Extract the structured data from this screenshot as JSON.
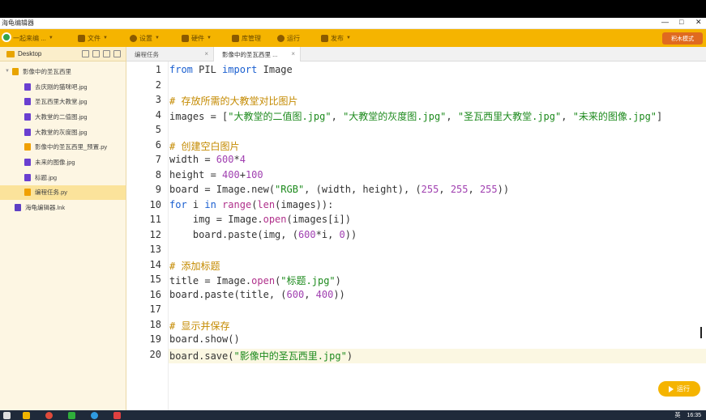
{
  "window": {
    "title": "海龟编辑器",
    "controls": [
      "—",
      "□",
      "✕"
    ]
  },
  "menubar": {
    "account": "一起来编 ...",
    "items": [
      {
        "label": "文件",
        "icon": "folder-icon"
      },
      {
        "label": "设置",
        "icon": "gear-icon"
      },
      {
        "label": "硬件",
        "icon": "hardware-icon"
      },
      {
        "label": "库管理",
        "icon": "library-icon"
      },
      {
        "label": "运行",
        "icon": "run-icon"
      },
      {
        "label": "发布",
        "icon": "publish-icon"
      }
    ],
    "mode_button": "积木模式"
  },
  "sidebar": {
    "root": "Desktop",
    "folder": "影像中的圣瓦西里",
    "files": [
      {
        "name": "去庆刚的猫咪吧.jpg",
        "type": "img"
      },
      {
        "name": "圣瓦西里大教堂.jpg",
        "type": "img"
      },
      {
        "name": "大教堂的二值图.jpg",
        "type": "img"
      },
      {
        "name": "大教堂的灰度图.jpg",
        "type": "img"
      },
      {
        "name": "影像中的圣瓦西里_预置.py",
        "type": "py"
      },
      {
        "name": "未来的图像.jpg",
        "type": "img"
      },
      {
        "name": "标题.jpg",
        "type": "img"
      },
      {
        "name": "编程任务.py",
        "type": "py",
        "selected": true
      }
    ],
    "extra": {
      "name": "海龟编辑器.lnk",
      "type": "lnk"
    }
  },
  "tabs": [
    {
      "label": "编程任务",
      "active": false
    },
    {
      "label": "影像中的圣瓦西里 ...",
      "active": true
    }
  ],
  "editor": {
    "highlight_line": 20,
    "lines": [
      [
        [
          "kw",
          "from"
        ],
        [
          "t",
          " PIL "
        ],
        [
          "kw",
          "import"
        ],
        [
          "t",
          " Image"
        ]
      ],
      [],
      [
        [
          "cm",
          "# 存放所需的大教堂对比图片"
        ]
      ],
      [
        [
          "t",
          "images = ["
        ],
        [
          "st",
          "\"大教堂的二值图.jpg\""
        ],
        [
          "t",
          ", "
        ],
        [
          "st",
          "\"大教堂的灰度图.jpg\""
        ],
        [
          "t",
          ", "
        ],
        [
          "st",
          "\"圣瓦西里大教堂.jpg\""
        ],
        [
          "t",
          ", "
        ],
        [
          "st",
          "\"未来的图像.jpg\""
        ],
        [
          "t",
          "]"
        ]
      ],
      [],
      [
        [
          "cm",
          "# 创建空白图片"
        ]
      ],
      [
        [
          "t",
          "width = "
        ],
        [
          "nm",
          "600"
        ],
        [
          "t",
          "*"
        ],
        [
          "nm",
          "4"
        ]
      ],
      [
        [
          "t",
          "height = "
        ],
        [
          "nm",
          "400"
        ],
        [
          "t",
          "+"
        ],
        [
          "nm",
          "100"
        ]
      ],
      [
        [
          "t",
          "board = Image.new("
        ],
        [
          "st",
          "\"RGB\""
        ],
        [
          "t",
          ", (width, height), ("
        ],
        [
          "nm",
          "255"
        ],
        [
          "t",
          ", "
        ],
        [
          "nm",
          "255"
        ],
        [
          "t",
          ", "
        ],
        [
          "nm",
          "255"
        ],
        [
          "t",
          "))"
        ]
      ],
      [
        [
          "kw",
          "for"
        ],
        [
          "t",
          " i "
        ],
        [
          "kw",
          "in"
        ],
        [
          "t",
          " "
        ],
        [
          "fn",
          "range"
        ],
        [
          "t",
          "("
        ],
        [
          "fn",
          "len"
        ],
        [
          "t",
          "(images)):"
        ]
      ],
      [
        [
          "t",
          "    img = Image."
        ],
        [
          "fn",
          "open"
        ],
        [
          "t",
          "(images[i])"
        ]
      ],
      [
        [
          "t",
          "    board.paste(img, ("
        ],
        [
          "nm",
          "600"
        ],
        [
          "t",
          "*i, "
        ],
        [
          "nm",
          "0"
        ],
        [
          "t",
          "))"
        ]
      ],
      [],
      [
        [
          "cm",
          "# 添加标题"
        ]
      ],
      [
        [
          "t",
          "title = Image."
        ],
        [
          "fn",
          "open"
        ],
        [
          "t",
          "("
        ],
        [
          "st",
          "\"标题.jpg\""
        ],
        [
          "t",
          ")"
        ]
      ],
      [
        [
          "t",
          "board.paste(title, ("
        ],
        [
          "nm",
          "600"
        ],
        [
          "t",
          ", "
        ],
        [
          "nm",
          "400"
        ],
        [
          "t",
          "))"
        ]
      ],
      [],
      [
        [
          "cm",
          "# 显示并保存"
        ]
      ],
      [
        [
          "t",
          "board.show()"
        ]
      ],
      [
        [
          "t",
          "board.save("
        ],
        [
          "st",
          "\"影像中的圣瓦西里.jpg\""
        ],
        [
          "t",
          ")"
        ]
      ]
    ]
  },
  "run_button": "运行",
  "taskbar": {
    "time": "16:35",
    "lang": "英"
  },
  "colors": {
    "accent": "#f5b400",
    "sidebar_bg": "#fdf6e3",
    "keyword": "#1a5fd0",
    "string": "#1d8a1d",
    "number": "#a03fb0",
    "comment": "#c48a00"
  }
}
